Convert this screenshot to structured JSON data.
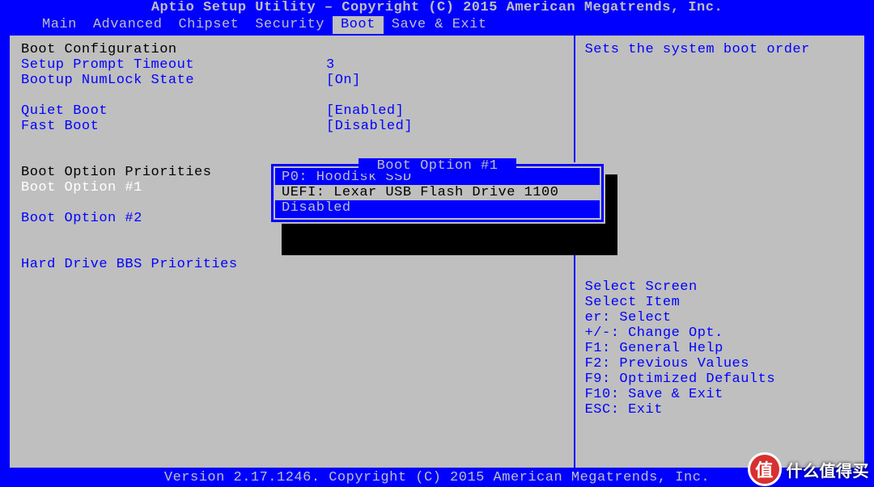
{
  "header": {
    "title": "Aptio Setup Utility – Copyright (C) 2015 American Megatrends, Inc."
  },
  "menu": {
    "items": [
      "Main",
      "Advanced",
      "Chipset",
      "Security",
      "Boot",
      "Save & Exit"
    ],
    "selected": "Boot"
  },
  "left": {
    "section1_title": "Boot Configuration",
    "rows": [
      {
        "label": "Setup Prompt Timeout",
        "value": "3",
        "label_cls": "blue",
        "val_cls": "blue"
      },
      {
        "label": "Bootup NumLock State",
        "value": "[On]",
        "label_cls": "blue",
        "val_cls": "blue"
      }
    ],
    "rows2": [
      {
        "label": "Quiet Boot",
        "value": "[Enabled]",
        "label_cls": "blue",
        "val_cls": "blue"
      },
      {
        "label": "Fast Boot",
        "value": "[Disabled]",
        "label_cls": "blue",
        "val_cls": "blue"
      }
    ],
    "section2_title": "Boot Option Priorities",
    "boot_opt1_label": "Boot Option #1",
    "boot_opt1_value": "[UEFI: Lexar USB Flash",
    "boot_opt2_label": "Boot Option #2",
    "hdd_bbs_label": "Hard Drive BBS Priorities"
  },
  "popup": {
    "title": "Boot Option #1",
    "options": [
      "P0: Hoodisk SSD",
      "UEFI: Lexar USB Flash Drive 1100",
      "Disabled"
    ],
    "selected_index": 1
  },
  "right": {
    "description": "Sets the system boot order",
    "help": [
      "    Select Screen",
      "    Select Item",
      "  er: Select",
      "+/-: Change Opt.",
      "F1: General Help",
      "F2: Previous Values",
      "F9: Optimized Defaults",
      "F10: Save & Exit",
      "ESC: Exit"
    ]
  },
  "footer": {
    "text": "Version 2.17.1246. Copyright (C) 2015 American Megatrends, Inc."
  },
  "watermark": {
    "badge": "值",
    "text": "什么值得买"
  }
}
